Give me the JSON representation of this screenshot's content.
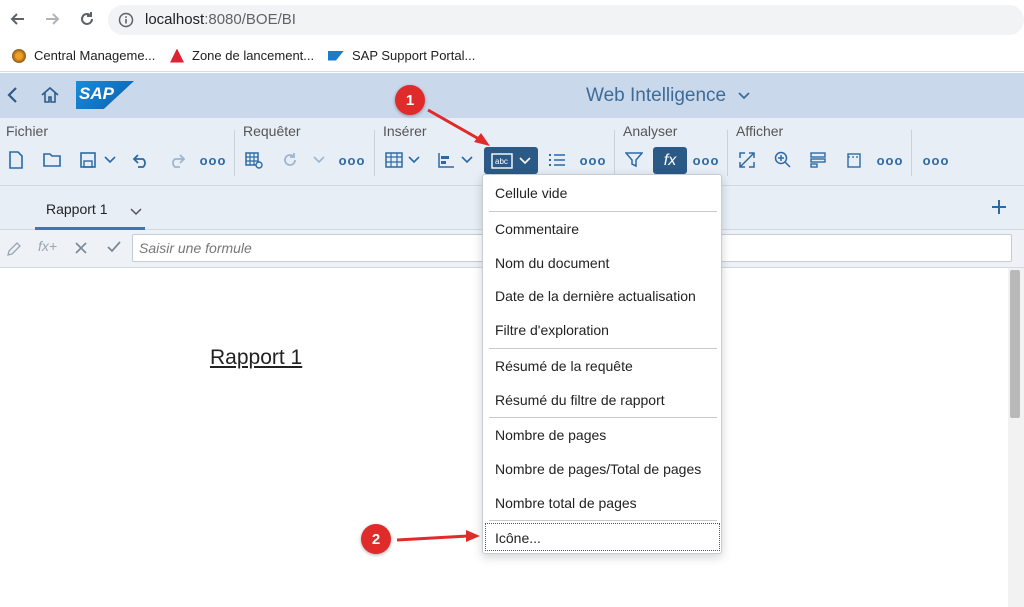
{
  "browser": {
    "url_host": "localhost",
    "url_rest": ":8080/BOE/BI",
    "bookmarks": [
      {
        "label": "Central Manageme..."
      },
      {
        "label": "Zone de lancement..."
      },
      {
        "label": "SAP Support Portal..."
      }
    ]
  },
  "shell": {
    "logo_text": "SAP",
    "app_title": "Web Intelligence"
  },
  "toolbar": {
    "groups": {
      "fichier": "Fichier",
      "requeter": "Requêter",
      "inserer": "Insérer",
      "analyser": "Analyser",
      "afficher": "Afficher"
    },
    "more": "ooo",
    "fx": "fx"
  },
  "tabs": {
    "active": "Rapport 1"
  },
  "formula": {
    "placeholder": "Saisir une formule",
    "fx_label": "fx+"
  },
  "report": {
    "title": "Rapport 1"
  },
  "menu": {
    "items": [
      "Cellule vide",
      "Commentaire",
      "Nom du document",
      "Date de la dernière actualisation",
      "Filtre d'exploration",
      "Résumé de la requête",
      "Résumé du filtre de rapport",
      "Nombre de pages",
      "Nombre de pages/Total de pages",
      "Nombre total de pages",
      "Icône..."
    ]
  },
  "annotations": {
    "step1": "1",
    "step2": "2",
    "color": "#e02b2b"
  },
  "colors": {
    "shell": "#c9d8ea",
    "toolbar": "#e8eef6",
    "accent": "#2b5a87",
    "icon": "#2b6aa6"
  }
}
